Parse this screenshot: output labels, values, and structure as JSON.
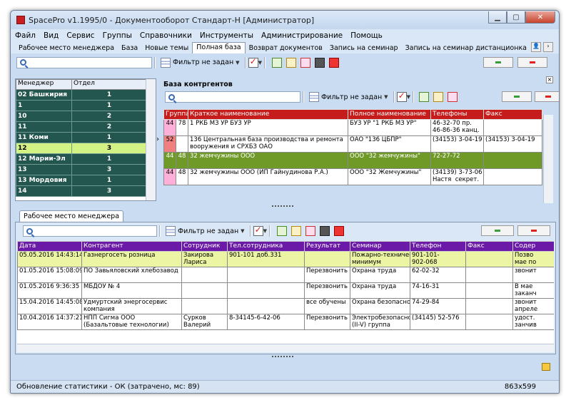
{
  "app": {
    "title": "SpacePro v1.1995/0 - Документооборот Стандарт-Н [Администратор]"
  },
  "menu": [
    "Файл",
    "Вид",
    "Сервис",
    "Группы",
    "Справочники",
    "Инструменты",
    "Администрирование",
    "Помощь"
  ],
  "tabs": [
    "Рабочее место менеджера",
    "База",
    "Новые темы",
    "Полная база",
    "Возврат документов",
    "Запись на семинар",
    "Запись на семинар дистанционка"
  ],
  "filter_label": "Фильтр не задан",
  "managers": {
    "headers": [
      "Менеджер",
      "Отдел"
    ],
    "rows": [
      [
        "02 Башкирия",
        "1"
      ],
      [
        "1",
        "1"
      ],
      [
        "10",
        "2"
      ],
      [
        "11",
        "2"
      ],
      [
        "11 Коми",
        "1"
      ],
      [
        "12",
        "3"
      ],
      [
        "12 Марии-Эл",
        "1"
      ],
      [
        "13",
        "3"
      ],
      [
        "13 Мордовия",
        "1"
      ],
      [
        "14",
        "3"
      ]
    ]
  },
  "contractors": {
    "title": "База контргентов",
    "headers": [
      "Группа",
      "Краткое наименование",
      "Полное наименование",
      "Телефоны",
      "Факс"
    ],
    "rows": [
      {
        "g": "44",
        "n": "78",
        "short": "1 РКБ МЗ УР БУЗ УР",
        "full": "БУЗ УР \"1 РКБ МЗ УР\"",
        "phone": "46-32-70 пр.\n46-86-36 канц.",
        "fax": ""
      },
      {
        "g": "52",
        "n": "",
        "short": "136 Центральная база производства и ремонта\nвооружения и СРХБЗ ОАО",
        "full": "ОАО \"136 ЦБПР\"",
        "phone": "(34153) 3-04-19",
        "fax": "(34153) 3-04-19"
      },
      {
        "g": "44",
        "n": "48",
        "short": "32 жемчужины ООО",
        "full": "ООО \"32 жемчужины\"",
        "phone": "72-27-72",
        "fax": ""
      },
      {
        "g": "44",
        "n": "48",
        "short": "32 жемчужины ООО (ИП Гайнудинова Р.А.)",
        "full": "ООО \"32 Жемчужины\"",
        "phone": "(34139) 3-73-06\nНастя  секрет.",
        "fax": ""
      }
    ]
  },
  "workplace": {
    "tab": "Рабочее место менеджера",
    "headers": [
      "Дата",
      "Контрагент",
      "Сотрудник",
      "Тел.сотрудника",
      "Результат",
      "Семинар",
      "Телефон",
      "Факс",
      "Содер"
    ],
    "rows": [
      [
        "05.05.2016 14:43:14",
        "Газнергосеть розница",
        "Закирова\nЛариса",
        "901-101 доб.331",
        "",
        "Пожарно-техничес\nминимум",
        "901-101-\n902-068",
        "",
        "Позво\nмае по"
      ],
      [
        "01.05.2016 15:08:09",
        "ПО Завьяловский хлебозавод",
        "",
        "",
        "Перезвонить",
        "Охрана труда",
        "62-02-32",
        "",
        "звонит"
      ],
      [
        "01.05.2016 9:36:35",
        "МБДОУ № 4",
        "",
        "",
        "Перезвонить",
        "Охрана труда",
        "74-16-31",
        "",
        "В мае\nзаканч"
      ],
      [
        "15.04.2016 14:45:08",
        "Удмуртский энергосервис\nкомпания",
        "",
        "",
        "все обучены",
        "Охрана безопасно",
        "74-29-84",
        "",
        "звонит\nапреле"
      ],
      [
        "10.04.2016 14:37:21",
        "НПП Сигма ООО\n(Базальтовые технологии)",
        "Сурков\nВалерий",
        "8-34145-6-42-06",
        "Перезвонить",
        "Электробезопасно\n(II-V) группа",
        "(34145)  52-576",
        "",
        "удост. \nзанчив"
      ]
    ]
  },
  "status": {
    "text": "Обновление статистики - ОК (затрачено, мс: 89)",
    "size": "863x599"
  }
}
